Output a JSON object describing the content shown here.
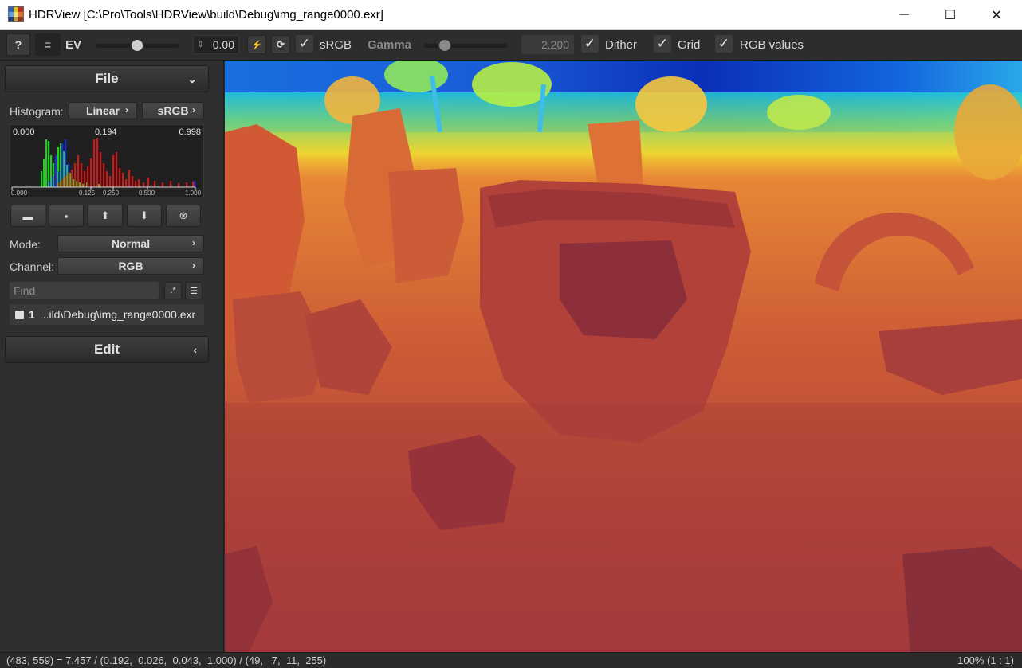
{
  "window": {
    "title": "HDRView [C:\\Pro\\Tools\\HDRView\\build\\Debug\\img_range0000.exr]",
    "minimize_glyph": "─",
    "maximize_glyph": "☐",
    "close_glyph": "✕"
  },
  "toolbar": {
    "help_label": "?",
    "menu_glyph": "≡",
    "ev_label": "EV",
    "ev_slider_value": 0.5,
    "ev_value": "0.00",
    "spin_glyph": "⇕",
    "flash_glyph": "⚡",
    "reset_glyph": "⟳",
    "srgb_label": "sRGB",
    "srgb_checked": true,
    "gamma_label": "Gamma",
    "gamma_slider_value": 0.25,
    "gamma_value": "2.200",
    "dither_label": "Dither",
    "dither_checked": true,
    "grid_label": "Grid",
    "grid_checked": true,
    "rgb_values_label": "RGB values",
    "rgb_values_checked": true,
    "check_glyph": "✓"
  },
  "sidebar": {
    "file_label": "File",
    "file_chevron": "⌄",
    "histogram_label": "Histogram:",
    "histogram_scale_label": "Linear",
    "histogram_space_label": "sRGB",
    "arrow_glyph": "›",
    "histogram": {
      "top_left": "0.000",
      "top_mid": "0.194",
      "top_right": "0.998",
      "ticks": [
        "0.000",
        "0.125",
        "0.250",
        "0.500",
        "1.000"
      ]
    },
    "file_buttons": [
      {
        "name": "open-icon",
        "glyph": "▬"
      },
      {
        "name": "save-icon",
        "glyph": "▪"
      },
      {
        "name": "up-icon",
        "glyph": "⬆"
      },
      {
        "name": "down-icon",
        "glyph": "⬇"
      },
      {
        "name": "close-icon",
        "glyph": "⊗"
      }
    ],
    "mode_label": "Mode:",
    "mode_value": "Normal",
    "channel_label": "Channel:",
    "channel_value": "RGB",
    "find_placeholder": "Find",
    "regex_label": ".*",
    "list_glyph": "☰",
    "file_item_index": "1",
    "file_item_name": "...ild\\Debug\\img_range0000.exr",
    "edit_label": "Edit",
    "edit_chevron": "‹"
  },
  "colors": {
    "accent": "#dcdcdc",
    "hist_red": "#d01818",
    "hist_green": "#22cc22",
    "hist_blue": "#1a2ee0"
  },
  "status": {
    "pixel_info": "(483, 559) = 7.457 / (0.192,  0.026,  0.043,  1.000) / (49,   7,  11,  255)",
    "zoom": "100% (1 : 1)"
  }
}
